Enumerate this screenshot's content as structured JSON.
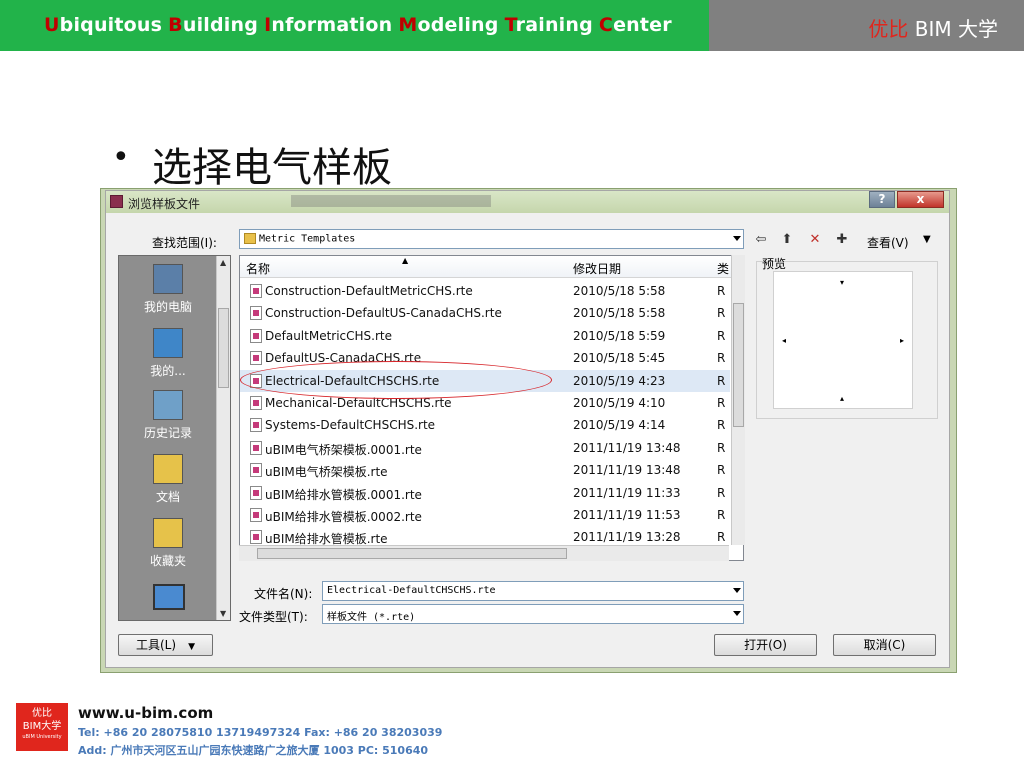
{
  "header": {
    "title_parts": [
      {
        "hl": "U",
        "rest": "biquitous"
      },
      {
        "hl": "B",
        "rest": "uilding"
      },
      {
        "hl": "I",
        "rest": "nformation"
      },
      {
        "hl": "M",
        "rest": "odeling"
      },
      {
        "hl": "T",
        "rest": "raining"
      },
      {
        "hl": "C",
        "rest": "enter"
      }
    ],
    "brand_cn": "优比",
    "brand_rest": " BIM 大学"
  },
  "slide": {
    "bullet_symbol": "•",
    "bullet_text": "选择电气样板"
  },
  "dialog": {
    "title": "浏览样板文件",
    "help_label": "?",
    "close_label": "x",
    "look_in_label": "查找范围(I):",
    "look_in_value": "Metric Templates",
    "views_label": "查看(V)",
    "columns": {
      "name": "名称",
      "date": "修改日期",
      "type": "类"
    },
    "files": [
      {
        "name": "Construction-DefaultMetricCHS.rte",
        "date": "2010/5/18 5:58",
        "type": "R"
      },
      {
        "name": "Construction-DefaultUS-CanadaCHS.rte",
        "date": "2010/5/18 5:58",
        "type": "R"
      },
      {
        "name": "DefaultMetricCHS.rte",
        "date": "2010/5/18 5:59",
        "type": "R"
      },
      {
        "name": "DefaultUS-CanadaCHS.rte",
        "date": "2010/5/18 5:45",
        "type": "R"
      },
      {
        "name": "Electrical-DefaultCHSCHS.rte",
        "date": "2010/5/19 4:23",
        "type": "R"
      },
      {
        "name": "Mechanical-DefaultCHSCHS.rte",
        "date": "2010/5/19 4:10",
        "type": "R"
      },
      {
        "name": "Systems-DefaultCHSCHS.rte",
        "date": "2010/5/19 4:14",
        "type": "R"
      },
      {
        "name": "uBIM电气桥架模板.0001.rte",
        "date": "2011/11/19 13:48",
        "type": "R"
      },
      {
        "name": "uBIM电气桥架模板.rte",
        "date": "2011/11/19 13:48",
        "type": "R"
      },
      {
        "name": "uBIM给排水管模板.0001.rte",
        "date": "2011/11/19 11:33",
        "type": "R"
      },
      {
        "name": "uBIM给排水管模板.0002.rte",
        "date": "2011/11/19 11:53",
        "type": "R"
      },
      {
        "name": "uBIM给排水管模板.rte",
        "date": "2011/11/19 13:28",
        "type": "R"
      }
    ],
    "selected_index": 4,
    "places": [
      {
        "label": "我的电脑",
        "icon": "computer-icon"
      },
      {
        "label": "我的...",
        "icon": "network-icon"
      },
      {
        "label": "历史记录",
        "icon": "history-icon"
      },
      {
        "label": "文档",
        "icon": "documents-icon"
      },
      {
        "label": "收藏夹",
        "icon": "favorites-icon"
      }
    ],
    "preview_label": "预览",
    "filename_label": "文件名(N):",
    "filename_value": "Electrical-DefaultCHSCHS.rte",
    "filetype_label": "文件类型(T):",
    "filetype_value": "样板文件 (*.rte)",
    "tools_label": "工具(L)",
    "open_label": "打开(O)",
    "cancel_label": "取消(C)"
  },
  "footer": {
    "logo_line1": "优比",
    "logo_line2": "BIM大学",
    "logo_line3": "uBIM University",
    "url": "www.u-bim.com",
    "tel": "Tel: +86 20 28075810    13719497324  Fax: +86 20 38203039",
    "addr": "Add: 广州市天河区五山广园东快速路广之旅大厦 1003  PC: 510640"
  },
  "colors": {
    "green": "#22b34a",
    "gray": "#808080",
    "red": "#e0261d",
    "highlight_ellipse": "#d7262b"
  }
}
